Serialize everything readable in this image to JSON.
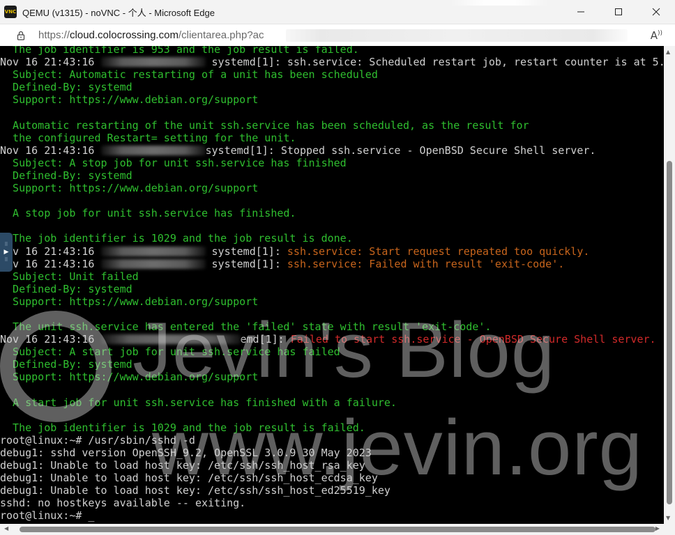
{
  "window": {
    "title": "QEMU (v1315) - noVNC - 个人 - Microsoft Edge",
    "app_icon_text": "VNC"
  },
  "address_bar": {
    "url_prefix": "https://",
    "url_host": "cloud.colocrossing.com",
    "url_path": "/clientarea.php?ac"
  },
  "terminal": {
    "lines": [
      {
        "color": "green",
        "parts": [
          {
            "t": "  The job identifier is 953 and the job result is failed."
          }
        ]
      },
      {
        "color": "white",
        "parts": [
          {
            "t": "Nov 16 21:43:16 "
          },
          {
            "blur": "normal"
          },
          {
            "t": " systemd[1]: ssh.service: Scheduled restart job, restart counter is at 5."
          }
        ]
      },
      {
        "color": "green",
        "parts": [
          {
            "t": "  Subject: Automatic restarting of a unit has been scheduled"
          }
        ]
      },
      {
        "color": "green",
        "parts": [
          {
            "t": "  Defined-By: systemd"
          }
        ]
      },
      {
        "color": "green",
        "parts": [
          {
            "t": "  Support: https://www.debian.org/support"
          }
        ]
      },
      {
        "color": "green",
        "parts": [
          {
            "t": ""
          }
        ]
      },
      {
        "color": "green",
        "parts": [
          {
            "t": "  Automatic restarting of the unit ssh.service has been scheduled, as the result for"
          }
        ]
      },
      {
        "color": "green",
        "parts": [
          {
            "t": "  the configured Restart= setting for the unit."
          }
        ]
      },
      {
        "color": "white",
        "parts": [
          {
            "t": "Nov 16 21:43:16 "
          },
          {
            "blur": "normal"
          },
          {
            "t": "systemd[1]: Stopped ssh.service - OpenBSD Secure Shell server."
          }
        ]
      },
      {
        "color": "green",
        "parts": [
          {
            "t": "  Subject: A stop job for unit ssh.service has finished"
          }
        ]
      },
      {
        "color": "green",
        "parts": [
          {
            "t": "  Defined-By: systemd"
          }
        ]
      },
      {
        "color": "green",
        "parts": [
          {
            "t": "  Support: https://www.debian.org/support"
          }
        ]
      },
      {
        "color": "green",
        "parts": [
          {
            "t": ""
          }
        ]
      },
      {
        "color": "green",
        "parts": [
          {
            "t": "  A stop job for unit ssh.service has finished."
          }
        ]
      },
      {
        "color": "green",
        "parts": [
          {
            "t": ""
          }
        ]
      },
      {
        "color": "green",
        "parts": [
          {
            "t": "  The job identifier is 1029 and the job result is done."
          }
        ]
      },
      {
        "color": "white",
        "parts": [
          {
            "t": "Nov 16 21:43:16 "
          },
          {
            "blur": "normal"
          },
          {
            "t": " systemd[1]: "
          },
          {
            "t": "ssh.service: Start request repeated too quickly.",
            "color": "orange"
          }
        ]
      },
      {
        "color": "white",
        "parts": [
          {
            "t": "Nov 16 21:43:16 "
          },
          {
            "blur": "normal"
          },
          {
            "t": " systemd[1]: "
          },
          {
            "t": "ssh.service: Failed with result 'exit-code'.",
            "color": "orange"
          }
        ]
      },
      {
        "color": "green",
        "parts": [
          {
            "t": "  Subject: Unit failed"
          }
        ]
      },
      {
        "color": "green",
        "parts": [
          {
            "t": "  Defined-By: systemd"
          }
        ]
      },
      {
        "color": "green",
        "parts": [
          {
            "t": "  Support: https://www.debian.org/support"
          }
        ]
      },
      {
        "color": "green",
        "parts": [
          {
            "t": ""
          }
        ]
      },
      {
        "color": "green",
        "parts": [
          {
            "t": "  The unit ssh.service has entered the 'failed' state with result 'exit-code'."
          }
        ]
      },
      {
        "color": "white",
        "parts": [
          {
            "t": "Nov 16 21:43:16 "
          },
          {
            "blur": "wide"
          },
          {
            "t": "emd[1]: "
          },
          {
            "t": "Failed to start ssh.service - OpenBSD Secure Shell server.",
            "color": "red"
          }
        ]
      },
      {
        "color": "green",
        "parts": [
          {
            "t": "  Subject: A start job for unit ssh.service has failed"
          }
        ]
      },
      {
        "color": "green",
        "parts": [
          {
            "t": "  Defined-By: systemd"
          }
        ]
      },
      {
        "color": "green",
        "parts": [
          {
            "t": "  Support: https://www.debian.org/support"
          }
        ]
      },
      {
        "color": "green",
        "parts": [
          {
            "t": ""
          }
        ]
      },
      {
        "color": "green",
        "parts": [
          {
            "t": "  A start job for unit ssh.service has finished with a failure."
          }
        ]
      },
      {
        "color": "green",
        "parts": [
          {
            "t": ""
          }
        ]
      },
      {
        "color": "green",
        "parts": [
          {
            "t": "  The job identifier is 1029 and the job result is failed."
          }
        ]
      },
      {
        "color": "white",
        "parts": [
          {
            "t": "root@linux:~# /usr/sbin/sshd -d"
          }
        ]
      },
      {
        "color": "white",
        "parts": [
          {
            "t": "debug1: sshd version OpenSSH_9.2, OpenSSL 3.0.9 30 May 2023"
          }
        ]
      },
      {
        "color": "white",
        "parts": [
          {
            "t": "debug1: Unable to load host key: /etc/ssh/ssh_host_rsa_key"
          }
        ]
      },
      {
        "color": "white",
        "parts": [
          {
            "t": "debug1: Unable to load host key: /etc/ssh/ssh_host_ecdsa_key"
          }
        ]
      },
      {
        "color": "white",
        "parts": [
          {
            "t": "debug1: Unable to load host key: /etc/ssh/ssh_host_ed25519_key"
          }
        ]
      },
      {
        "color": "white",
        "parts": [
          {
            "t": "sshd: no hostkeys available -- exiting."
          }
        ]
      },
      {
        "color": "white",
        "parts": [
          {
            "t": "root@linux:~# _"
          }
        ]
      }
    ]
  },
  "watermark": {
    "line1": "Jevin's Blog",
    "line2": "www.jevin.org"
  },
  "colors": {
    "green": "#2fbf2f",
    "white": "#d0d0d0",
    "orange": "#c8651c",
    "red": "#d12a2a"
  },
  "icons": {
    "app": "vnc-app-icon",
    "lock": "lock-icon",
    "read_aloud": "read-aloud-icon",
    "minimize": "minimize-icon",
    "maximize": "maximize-icon",
    "close": "close-icon",
    "novnc_control": "novnc-control-handle-icon"
  }
}
